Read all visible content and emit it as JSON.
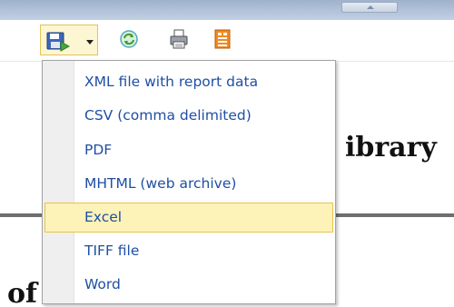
{
  "toolbar": {
    "export_icon": "save-export-icon",
    "refresh_icon": "refresh-icon",
    "print_icon": "printer-icon",
    "layout_icon": "print-layout-icon"
  },
  "report": {
    "heading_fragment": "ibrary",
    "text_fragment": "of"
  },
  "export_menu": {
    "items": [
      {
        "label": "XML file with report data"
      },
      {
        "label": "CSV (comma delimited)"
      },
      {
        "label": "PDF"
      },
      {
        "label": "MHTML (web archive)"
      },
      {
        "label": "Excel",
        "highlighted": true
      },
      {
        "label": "TIFF file"
      },
      {
        "label": "Word"
      }
    ]
  },
  "colors": {
    "menu_text": "#1f4fa3",
    "highlight_bg": "#fdf2b8",
    "highlight_border": "#e7c24a",
    "toolbar_strip": "#b4c3d8"
  }
}
